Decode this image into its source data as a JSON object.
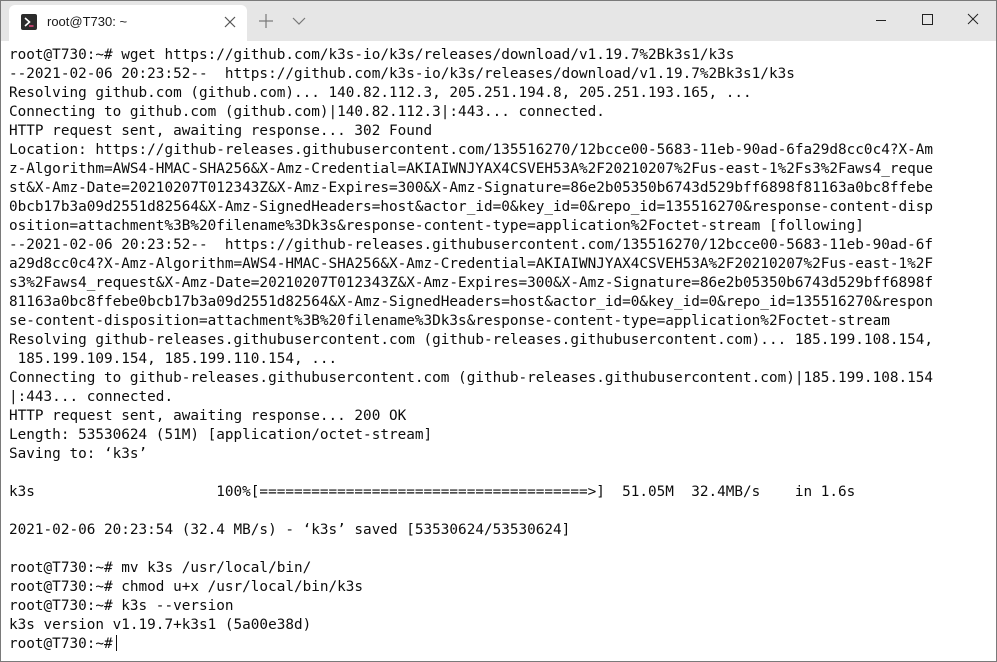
{
  "window": {
    "tab_title": "root@T730: ~",
    "icons": {
      "tab_icon": "powershell-prompt-icon",
      "tab_close": "close-icon",
      "new_tab": "plus-icon",
      "tab_dropdown": "chevron-down-icon",
      "minimize": "minimize-icon",
      "maximize": "maximize-icon",
      "close": "close-icon"
    }
  },
  "colors": {
    "titlebar_bg": "#e6e6e6",
    "tab_bg": "#ffffff",
    "terminal_bg": "#ffffff",
    "terminal_fg": "#0c0c0c"
  },
  "terminal": {
    "lines": [
      "root@T730:~# wget https://github.com/k3s-io/k3s/releases/download/v1.19.7%2Bk3s1/k3s",
      "--2021-02-06 20:23:52--  https://github.com/k3s-io/k3s/releases/download/v1.19.7%2Bk3s1/k3s",
      "Resolving github.com (github.com)... 140.82.112.3, 205.251.194.8, 205.251.193.165, ...",
      "Connecting to github.com (github.com)|140.82.112.3|:443... connected.",
      "HTTP request sent, awaiting response... 302 Found",
      "Location: https://github-releases.githubusercontent.com/135516270/12bcce00-5683-11eb-90ad-6fa29d8cc0c4?X-Am",
      "z-Algorithm=AWS4-HMAC-SHA256&X-Amz-Credential=AKIAIWNJYAX4CSVEH53A%2F20210207%2Fus-east-1%2Fs3%2Faws4_reque",
      "st&X-Amz-Date=20210207T012343Z&X-Amz-Expires=300&X-Amz-Signature=86e2b05350b6743d529bff6898f81163a0bc8ffebe",
      "0bcb17b3a09d2551d82564&X-Amz-SignedHeaders=host&actor_id=0&key_id=0&repo_id=135516270&response-content-disp",
      "osition=attachment%3B%20filename%3Dk3s&response-content-type=application%2Foctet-stream [following]",
      "--2021-02-06 20:23:52--  https://github-releases.githubusercontent.com/135516270/12bcce00-5683-11eb-90ad-6f",
      "a29d8cc0c4?X-Amz-Algorithm=AWS4-HMAC-SHA256&X-Amz-Credential=AKIAIWNJYAX4CSVEH53A%2F20210207%2Fus-east-1%2F",
      "s3%2Faws4_request&X-Amz-Date=20210207T012343Z&X-Amz-Expires=300&X-Amz-Signature=86e2b05350b6743d529bff6898f",
      "81163a0bc8ffebe0bcb17b3a09d2551d82564&X-Amz-SignedHeaders=host&actor_id=0&key_id=0&repo_id=135516270&respon",
      "se-content-disposition=attachment%3B%20filename%3Dk3s&response-content-type=application%2Foctet-stream",
      "Resolving github-releases.githubusercontent.com (github-releases.githubusercontent.com)... 185.199.108.154,",
      " 185.199.109.154, 185.199.110.154, ...",
      "Connecting to github-releases.githubusercontent.com (github-releases.githubusercontent.com)|185.199.108.154",
      "|:443... connected.",
      "HTTP request sent, awaiting response... 200 OK",
      "Length: 53530624 (51M) [application/octet-stream]",
      "Saving to: ‘k3s’",
      "",
      "k3s                     100%[======================================>]  51.05M  32.4MB/s    in 1.6s",
      "",
      "2021-02-06 20:23:54 (32.4 MB/s) - ‘k3s’ saved [53530624/53530624]",
      "",
      "root@T730:~# mv k3s /usr/local/bin/",
      "root@T730:~# chmod u+x /usr/local/bin/k3s",
      "root@T730:~# k3s --version",
      "k3s version v1.19.7+k3s1 (5a00e38d)",
      "root@T730:~#"
    ]
  }
}
